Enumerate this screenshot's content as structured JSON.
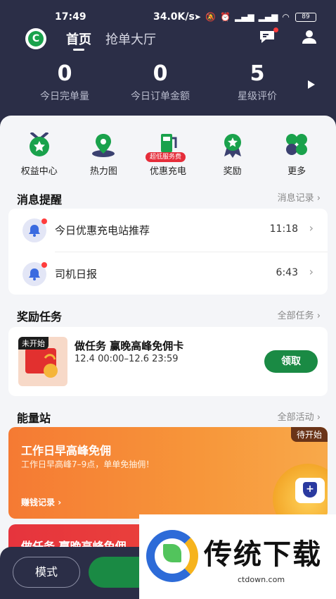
{
  "status_bar": {
    "time": "17:49",
    "network_speed": "34.0K/s",
    "battery": "89"
  },
  "nav": {
    "tabs": [
      {
        "label": "首页",
        "active": true
      },
      {
        "label": "抢单大厅",
        "active": false
      }
    ]
  },
  "stats": [
    {
      "value": "0",
      "label": "今日完单量"
    },
    {
      "value": "0",
      "label": "今日订单金额"
    },
    {
      "value": "5",
      "label": "星级评价"
    }
  ],
  "quick_actions": [
    {
      "label": "权益中心",
      "icon": "benefits-icon"
    },
    {
      "label": "热力图",
      "icon": "heatmap-icon"
    },
    {
      "label": "优惠充电",
      "icon": "charging-icon",
      "badge": "超低服务费"
    },
    {
      "label": "奖励",
      "icon": "reward-icon"
    },
    {
      "label": "更多",
      "icon": "more-icon"
    }
  ],
  "messages": {
    "title": "消息提醒",
    "more": "消息记录",
    "items": [
      {
        "title": "今日优惠充电站推荐",
        "time": "11:18"
      },
      {
        "title": "司机日报",
        "time": "6:43"
      }
    ]
  },
  "tasks": {
    "title": "奖励任务",
    "more": "全部任务",
    "item": {
      "tag": "未开始",
      "title": "做任务 赢晚高峰免佣卡",
      "time_range": "12.4 00:00–12.6 23:59",
      "button": "领取"
    }
  },
  "energy": {
    "title": "能量站",
    "more": "全部活动",
    "banner": {
      "badge": "待开始",
      "title": "工作日早高峰免佣",
      "subtitle": "工作日早高峰7–9点，单单免抽佣！",
      "link": "赚钱记录"
    },
    "banner2_title": "做任务 赢晚高峰免佣"
  },
  "bottom": {
    "mode_label": "模式"
  },
  "watermark": {
    "text": "传统下载",
    "url": "ctdown.com"
  },
  "colors": {
    "header_bg": "#2b2e47",
    "accent_green": "#1a8a44",
    "banner_orange": "#f57a33",
    "banner_red": "#e6343d"
  }
}
